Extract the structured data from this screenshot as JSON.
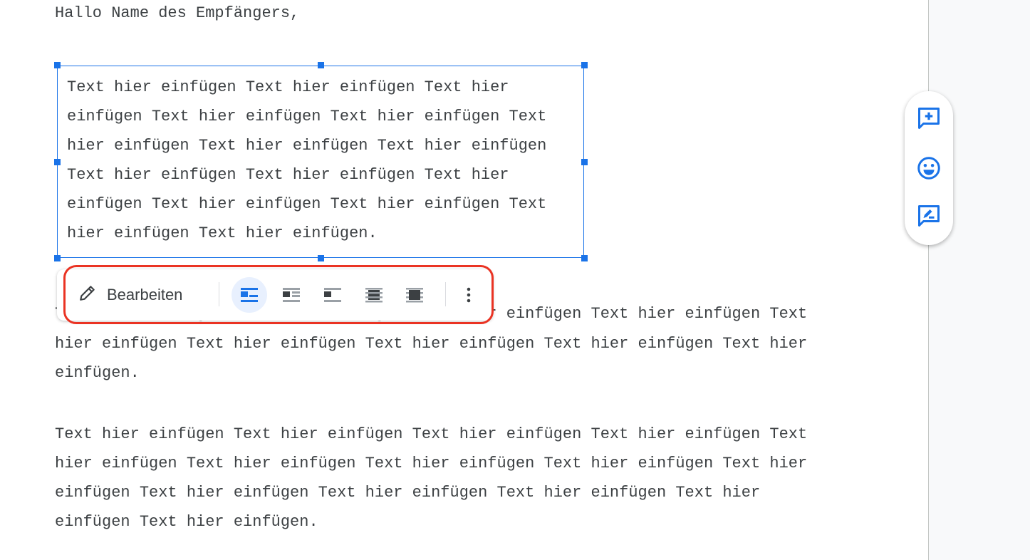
{
  "document": {
    "greeting": "Hallo Name des Empfängers,",
    "image_box_lines": [
      "Text hier einfügen Text hier einfügen Text hier",
      "einfügen Text hier einfügen Text hier einfügen Text",
      "hier einfügen Text hier einfügen Text hier einfügen",
      "Text hier einfügen Text hier einfügen Text hier",
      "einfügen Text hier einfügen Text hier einfügen Text",
      "hier einfügen Text hier einfügen."
    ],
    "paragraph1_lines": [
      "Text hier einfügen Text hier einfügen Text hier einfügen Text hier einfügen Text",
      "hier einfügen Text hier einfügen Text hier einfügen Text hier einfügen Text hier",
      "einfügen."
    ],
    "paragraph2_lines": [
      "Text hier einfügen Text hier einfügen Text hier einfügen Text hier einfügen Text",
      "hier einfügen Text hier einfügen Text hier einfügen Text hier einfügen Text hier",
      "einfügen Text hier einfügen Text hier einfügen Text hier einfügen Text hier",
      "einfügen Text hier einfügen."
    ]
  },
  "image_toolbar": {
    "edit_label": "Bearbeiten",
    "edit_icon": "pencil-icon",
    "wrap_options": [
      "in-line",
      "wrap-text",
      "break-text",
      "behind-text",
      "in-front-of-text"
    ],
    "selected_wrap": "in-line",
    "more_icon": "more-vert-icon"
  },
  "side_actions": [
    "add-comment-icon",
    "emoji-reaction-icon",
    "suggest-edits-icon"
  ],
  "colors": {
    "accent": "#1a73e8",
    "highlight": "#ea3323",
    "selected_bg": "#e8f0fe"
  }
}
